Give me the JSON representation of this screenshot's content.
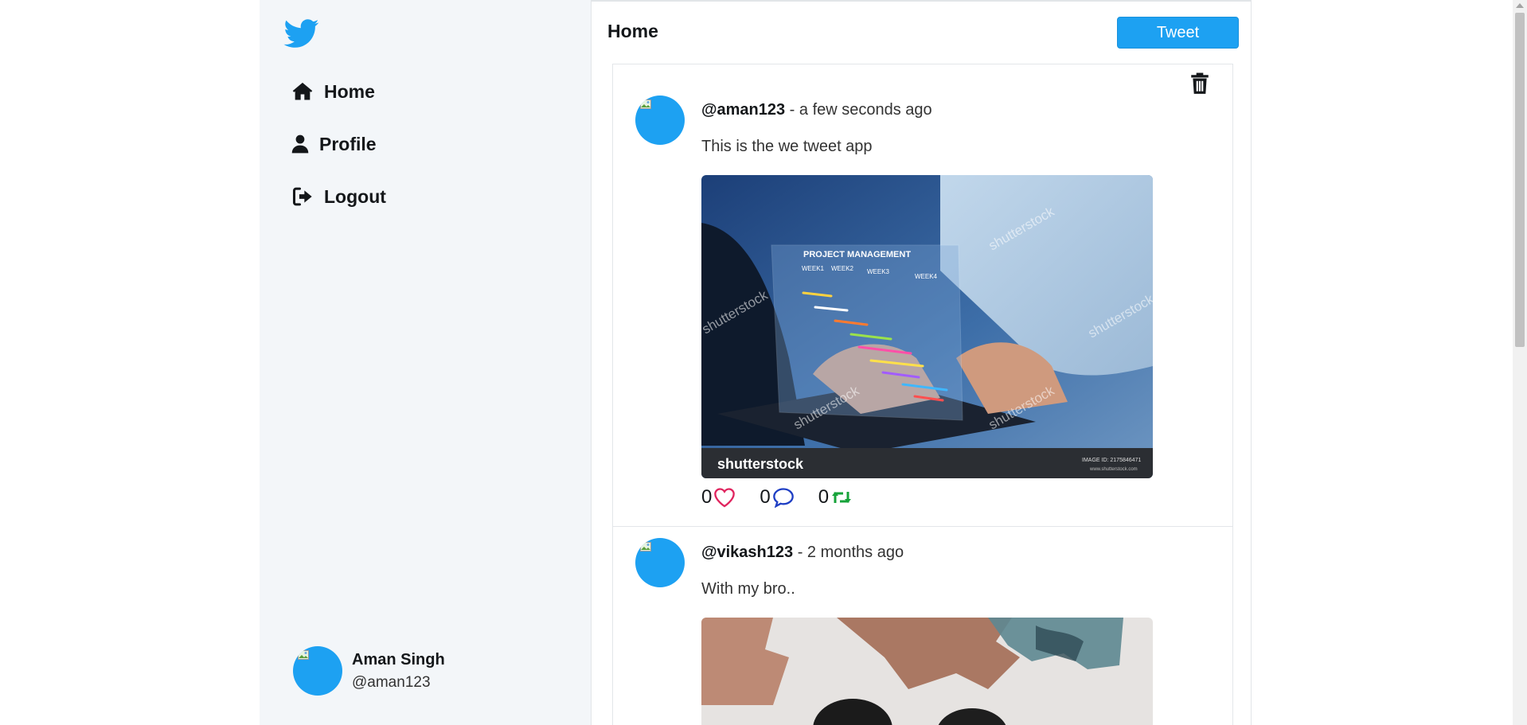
{
  "sidebar": {
    "logo": "twitter-bird-icon",
    "nav": [
      {
        "label": "Home",
        "icon": "home-icon"
      },
      {
        "label": "Profile",
        "icon": "user-icon"
      },
      {
        "label": "Logout",
        "icon": "logout-icon"
      }
    ],
    "user": {
      "name": "Aman Singh",
      "handle": "@aman123"
    }
  },
  "header": {
    "title": "Home",
    "tweet_button": "Tweet"
  },
  "tweets": [
    {
      "handle": "@aman123",
      "time": " - a few seconds ago",
      "text": "This is the we tweet app",
      "likes": "0",
      "comments": "0",
      "retweets": "0",
      "image": {
        "watermark": "shutterstock",
        "headline": "PROJECT MANAGEMENT",
        "weeks": [
          "WEEK1",
          "WEEK2",
          "WEEK3",
          "WEEK4"
        ],
        "image_id": "IMAGE ID: 2175846471",
        "site": "www.shutterstock.com"
      }
    },
    {
      "handle": "@vikash123",
      "time": " - 2 months ago",
      "text": "With my bro.."
    }
  ],
  "colors": {
    "accent": "#1da1f2",
    "like": "#e0245e",
    "comment": "#1f3fc4",
    "retweet": "#17a33a"
  }
}
